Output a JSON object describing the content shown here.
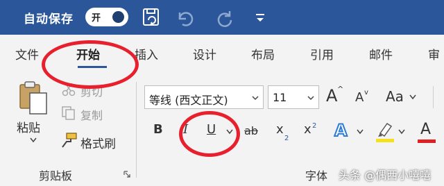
{
  "titlebar": {
    "autosave_label": "自动保存",
    "toggle_label": "开",
    "icons": [
      "save-sync-icon",
      "undo-icon",
      "redo-icon",
      "customize-quick-access-icon"
    ]
  },
  "tabs": [
    {
      "label": "文件",
      "active": false
    },
    {
      "label": "开始",
      "active": true
    },
    {
      "label": "插入",
      "active": false
    },
    {
      "label": "设计",
      "active": false
    },
    {
      "label": "布局",
      "active": false
    },
    {
      "label": "引用",
      "active": false
    },
    {
      "label": "邮件",
      "active": false
    },
    {
      "label": "审",
      "active": false
    }
  ],
  "clipboard": {
    "paste_label": "粘贴",
    "cut_label": "剪切",
    "copy_label": "复制",
    "format_painter_label": "格式刷",
    "group_label": "剪贴板"
  },
  "font": {
    "font_name": "等线 (西文正文)",
    "font_size": "11",
    "change_case_label": "Aa",
    "grow_label": "A",
    "shrink_label": "A",
    "bold_label": "B",
    "italic_label": "I",
    "underline_label": "U",
    "strikethrough_label": "ab",
    "subscript_label": "x",
    "subscript_small": "2",
    "superscript_label": "x",
    "superscript_small": "2",
    "text_effects_label": "A",
    "font_color_label": "A",
    "group_label": "字体"
  },
  "watermark": "头条 @偶西小嘻嘻",
  "colors": {
    "titlebar": "#2b579a",
    "annotation_red": "#e8202e",
    "highlight_yellow": "#f5e11a",
    "font_color_red": "#e02020",
    "text_effects_blue": "#2b7cd3"
  }
}
